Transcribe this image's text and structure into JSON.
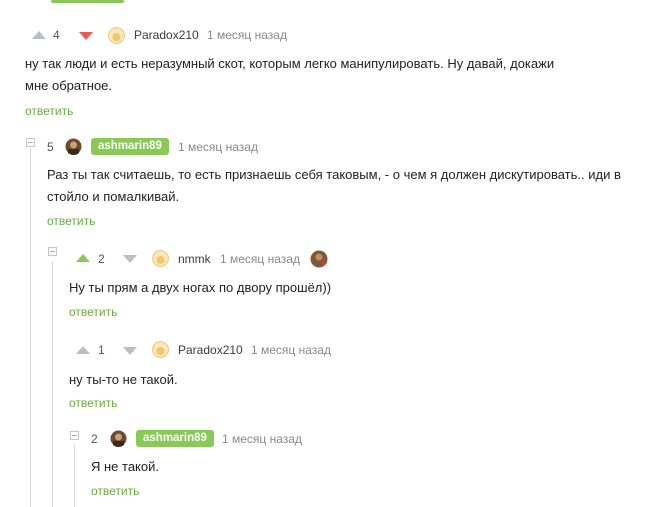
{
  "comments": [
    {
      "rating": "4",
      "user": "Paradox210",
      "time": "1 месяц назад",
      "text_lines": [
        "ну так люди и есть неразумный скот, которым легко манипулировать. Ну давай, докажи",
        "мне обратное."
      ],
      "reply": "ответить"
    },
    {
      "count": "5",
      "user": "ashmarin89",
      "time": "1 месяц назад",
      "text_lines": [
        "Раз ты так считаешь, то есть признаешь себя таковым, - о чем я должен дискутировать.. иди в",
        "стойло и помалкивай."
      ],
      "reply": "ответить"
    },
    {
      "rating": "2",
      "user": "nmmk",
      "time": "1 месяц назад",
      "text_lines": [
        "Ну ты прям а двух ногах по двору прошёл))"
      ],
      "reply": "ответить"
    },
    {
      "rating": "1",
      "user": "Paradox210",
      "time": "1 месяц назад",
      "text_lines": [
        "ну ты-то не такой."
      ],
      "reply": "ответить"
    },
    {
      "count": "2",
      "user": "ashmarin89",
      "time": "1 месяц назад",
      "text_lines": [
        "Я не такой."
      ],
      "reply": "ответить"
    }
  ],
  "colors": {
    "accent": "#8ac858",
    "downvote": "#e85a55",
    "reply": "#6aab3f",
    "muted": "#8a8a8a"
  },
  "icons": [
    "upvote-icon",
    "downvote-icon",
    "collapse-icon",
    "avatar-icon"
  ]
}
